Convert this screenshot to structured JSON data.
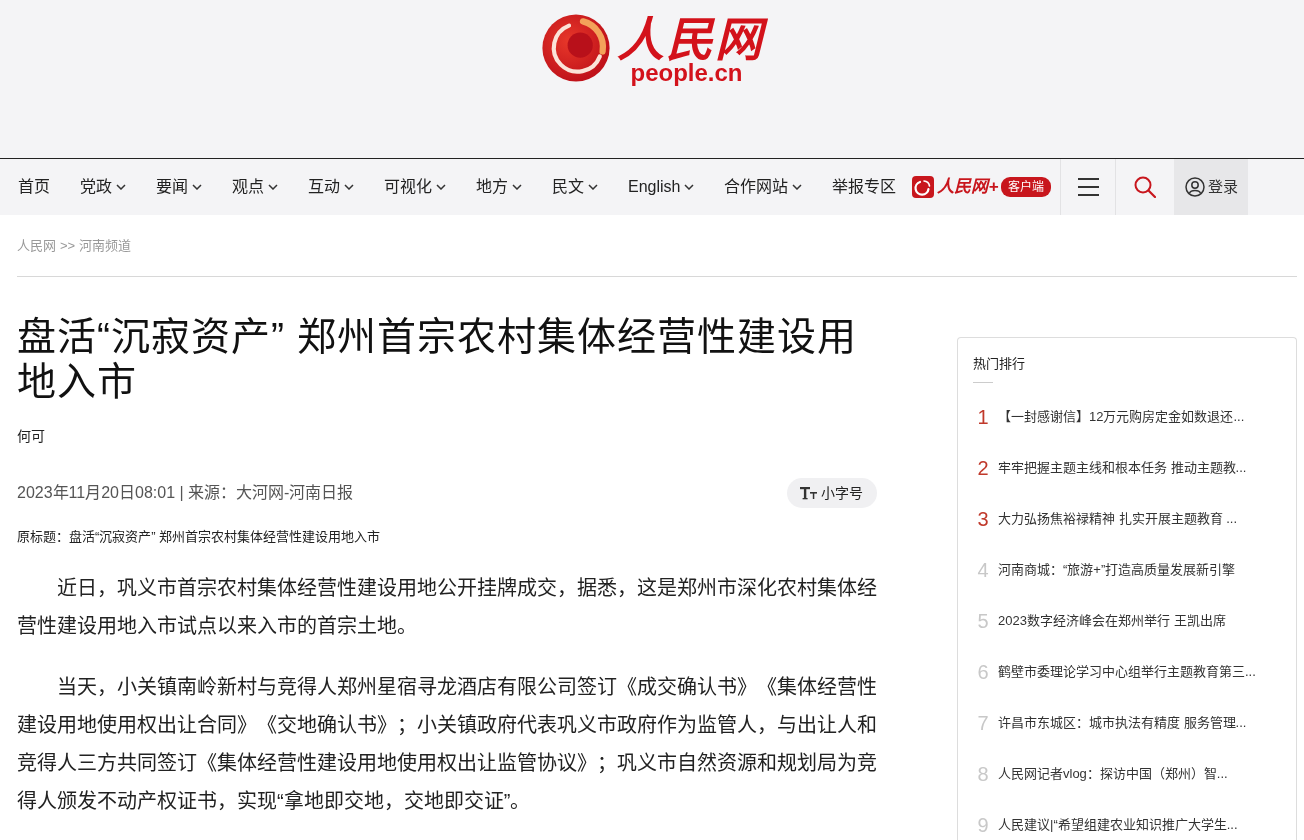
{
  "header": {
    "logo": {
      "name": "人民网",
      "domain": "people.cn"
    }
  },
  "nav": {
    "items": [
      {
        "label": "首页",
        "dropdown": false
      },
      {
        "label": "党政",
        "dropdown": true
      },
      {
        "label": "要闻",
        "dropdown": true
      },
      {
        "label": "观点",
        "dropdown": true
      },
      {
        "label": "互动",
        "dropdown": true
      },
      {
        "label": "可视化",
        "dropdown": true
      },
      {
        "label": "地方",
        "dropdown": true
      },
      {
        "label": "民文",
        "dropdown": true
      },
      {
        "label": "English",
        "dropdown": true
      },
      {
        "label": "合作网站",
        "dropdown": true
      },
      {
        "label": "举报专区",
        "dropdown": false
      }
    ],
    "app": {
      "name": "人民网+",
      "badge": "客户端"
    },
    "login": "登录"
  },
  "breadcrumb": {
    "items": [
      "人民网",
      "河南频道"
    ],
    "separator": ">>"
  },
  "article": {
    "title": "盘活“沉寂资产” 郑州首宗农村集体经营性建设用地入市",
    "author": "何可",
    "meta": "2023年11月20日08:01 | 来源：",
    "source": "大河网-河南日报",
    "font_size_button": "小字号",
    "original_title": "原标题：盘活“沉寂资产” 郑州首宗农村集体经营性建设用地入市",
    "paragraphs": [
      "近日，巩义市首宗农村集体经营性建设用地公开挂牌成交，据悉，这是郑州市深化农村集体经营性建设用地入市试点以来入市的首宗土地。",
      "当天，小关镇南岭新村与竞得人郑州星宿寻龙酒店有限公司签订《成交确认书》《集体经营性建设用地使用权出让合同》《交地确认书》；小关镇政府代表巩义市政府作为监管人，与出让人和竞得人三方共同签订《集体经营性建设用地使用权出让监管协议》；巩义市自然资源和规划局为竞得人颁发不动产权证书，实现“拿地即交地，交地即交证”。"
    ]
  },
  "sidebar": {
    "title": "热门排行",
    "items": [
      {
        "rank": "1",
        "title": "【一封感谢信】12万元购房定金如数退还...",
        "highlighted": true
      },
      {
        "rank": "2",
        "title": "牢牢把握主题主线和根本任务 推动主题教...",
        "highlighted": true
      },
      {
        "rank": "3",
        "title": "大力弘扬焦裕禄精神 扎实开展主题教育 ...",
        "highlighted": true
      },
      {
        "rank": "4",
        "title": "河南商城：“旅游+”打造高质量发展新引擎",
        "highlighted": false
      },
      {
        "rank": "5",
        "title": "2023数字经济峰会在郑州举行 王凯出席",
        "highlighted": false
      },
      {
        "rank": "6",
        "title": "鹤壁市委理论学习中心组举行主题教育第三...",
        "highlighted": false
      },
      {
        "rank": "7",
        "title": "许昌市东城区：城市执法有精度 服务管理...",
        "highlighted": false
      },
      {
        "rank": "8",
        "title": "人民网记者vlog：探访中国（郑州）智...",
        "highlighted": false
      },
      {
        "rank": "9",
        "title": "人民建议|“希望组建农业知识推广大学生...",
        "highlighted": false
      }
    ]
  }
}
